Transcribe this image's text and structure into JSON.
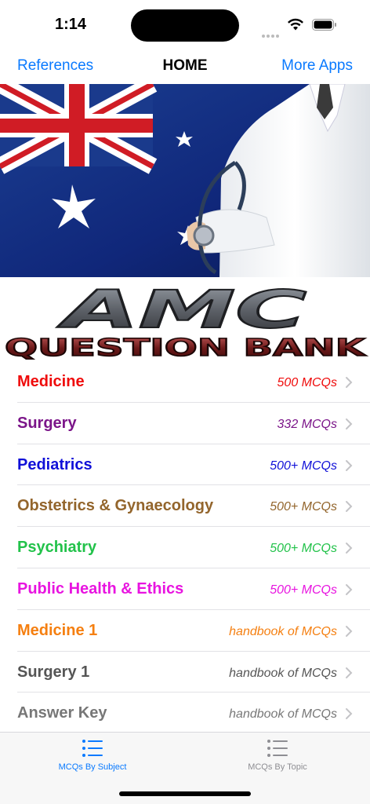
{
  "status": {
    "time": "1:14"
  },
  "nav": {
    "left": "References",
    "title": "HOME",
    "right": "More Apps"
  },
  "logo": {
    "line1": "AMC",
    "line2": "QUESTION BANK"
  },
  "items": [
    {
      "label": "Medicine",
      "detail": "500 MCQs",
      "color": "#ef0b0b"
    },
    {
      "label": "Surgery",
      "detail": "332 MCQs",
      "color": "#7b1589"
    },
    {
      "label": "Pediatrics",
      "detail": "500+ MCQs",
      "color": "#1010d8"
    },
    {
      "label": "Obstetrics & Gynaecology",
      "detail": "500+ MCQs",
      "color": "#93652c"
    },
    {
      "label": "Psychiatry",
      "detail": "500+ MCQs",
      "color": "#22c24a"
    },
    {
      "label": "Public Health & Ethics",
      "detail": "500+ MCQs",
      "color": "#e814e0"
    },
    {
      "label": "Medicine 1",
      "detail": "handbook of MCQs",
      "color": "#f57f10"
    },
    {
      "label": "Surgery 1",
      "detail": "handbook of MCQs",
      "color": "#555555"
    },
    {
      "label": "Answer Key",
      "detail": "handbook of MCQs",
      "color": "#777777"
    }
  ],
  "tabs": [
    {
      "label": "MCQs By Subject",
      "icon": "list-bullet-icon",
      "active": true
    },
    {
      "label": "MCQs By Topic",
      "icon": "list-bullet-icon",
      "active": false
    }
  ],
  "colors": {
    "accent": "#0a7aff",
    "tab_inactive": "#8e8e93"
  }
}
